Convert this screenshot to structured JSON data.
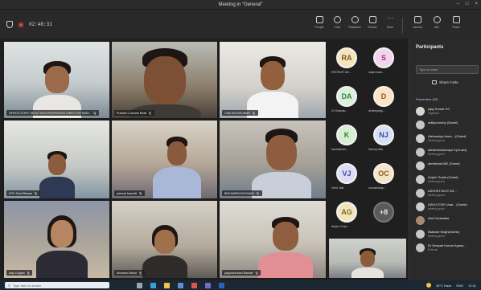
{
  "window": {
    "title": "Meeting in \"General\""
  },
  "toolbar": {
    "timer": "02:48:31",
    "buttons": [
      {
        "label": "People",
        "icon": "people-icon"
      },
      {
        "label": "Chat",
        "icon": "chat-icon"
      },
      {
        "label": "Reactions",
        "icon": "reactions-icon"
      },
      {
        "label": "Rooms",
        "icon": "rooms-icon"
      },
      {
        "label": "More",
        "icon": "more-icon"
      },
      {
        "label": "Camera",
        "icon": "camera-icon"
      },
      {
        "label": "Mic",
        "icon": "mic-icon"
      },
      {
        "label": "Share",
        "icon": "share-icon"
      }
    ]
  },
  "tiles": [
    {
      "name": "OFFICE STAFF SELECTION PROFESSOR DIRECTOR NADI..."
    },
    {
      "name": "Praveen Cuknath Bhatt"
    },
    {
      "name": "CMA RAJIVKUMAR"
    },
    {
      "name": "MTH  Sunil Biswas"
    },
    {
      "name": "parmod kaushik"
    },
    {
      "name": "BRCAMRDGK/EXAMS"
    },
    {
      "name": "Anju Dugtan"
    },
    {
      "name": "Monisha Gahlot"
    },
    {
      "name": "jaigurukenduri Rawale"
    }
  ],
  "avatars": [
    {
      "initials": "RA",
      "caption": "RECRUIT AD...",
      "color": "#f6e3b8",
      "text": "#6b5a2f"
    },
    {
      "initials": "S",
      "caption": "saiyr.exam...",
      "color": "#f3d3ee",
      "text": "#8a3f87"
    },
    {
      "initials": "DA",
      "caption": "Dr Deepak...",
      "color": "#d8f1d9",
      "text": "#3c7a44"
    },
    {
      "initials": "D",
      "caption": "dcdeepakg...",
      "color": "#fbe2c4",
      "text": "#8a5a1a"
    },
    {
      "initials": "K",
      "caption": "kaushikram...",
      "color": "#d6efd2",
      "text": "#3f7a3b"
    },
    {
      "initials": "NJ",
      "caption": "Neeraj Jain",
      "color": "#d5e0f7",
      "text": "#34508c"
    },
    {
      "initials": "VJ",
      "caption": "Vinni Jain",
      "color": "#dcdcf7",
      "text": "#4b4b94"
    },
    {
      "initials": "OC",
      "caption": "occhandrap...",
      "color": "#f8e3c8",
      "text": "#8a6126"
    },
    {
      "initials": "AG",
      "caption": "Anjani Gupt...",
      "color": "#f2e6b9",
      "text": "#7a6a2b"
    },
    {
      "initials": "+8",
      "caption": "",
      "color": "#5a5a5a",
      "text": "#e0e0e0"
    }
  ],
  "panel": {
    "title": "Participants",
    "search_placeholder": "Type a name",
    "share_label": "Share invite",
    "section": "Presenters (33)",
    "participants": [
      {
        "name": "Ajay Kumar KC",
        "role": "Organizer"
      },
      {
        "name": "aditya.bochy (Guest)",
        "role": ""
      },
      {
        "name": "Aishwariya Anan... (Guest)",
        "role": "Meeting guest"
      },
      {
        "name": "akhileshrawmaya C(Guest)",
        "role": "Meeting guest"
      },
      {
        "name": "akmishra1082 (Guest)",
        "role": ""
      },
      {
        "name": "Anjani Gupta (Guest)",
        "role": "Meeting guest"
      },
      {
        "name": "ASHISH DIXIT AS...",
        "role": "Meeting guest"
      },
      {
        "name": "ASHUTOSH Vaai... (Guest)",
        "role": "Meeting guest"
      },
      {
        "name": "Atul Godwatka",
        "role": ""
      },
      {
        "name": "Balwant Singh(Guest)",
        "role": "Meeting guest"
      },
      {
        "name": "Dr Deepak Kumar Agrwa...",
        "role": "External"
      }
    ]
  },
  "taskbar": {
    "search": "Type here to search",
    "weather": "26°C Haze",
    "lang": "ENG",
    "time": "12:41"
  }
}
